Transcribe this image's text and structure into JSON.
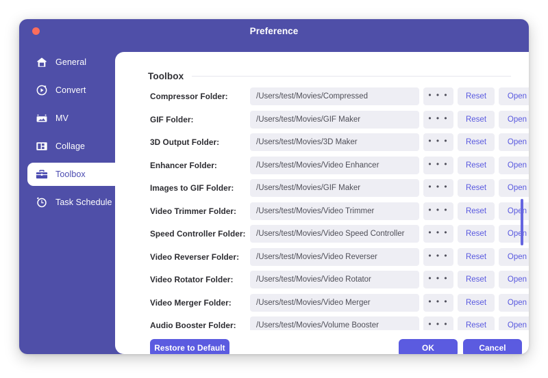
{
  "window": {
    "title": "Preference",
    "close_label": "close",
    "accent_color": "#5b5be0",
    "sidebar_color": "#4f4fa8",
    "close_color": "#fb6d5c",
    "field_bg_color": "#eeeef4",
    "link_color": "#5858df"
  },
  "sidebar": {
    "items": [
      {
        "label": "General",
        "icon": "home-icon",
        "active": false
      },
      {
        "label": "Convert",
        "icon": "convert-icon",
        "active": false
      },
      {
        "label": "MV",
        "icon": "mv-icon",
        "active": false
      },
      {
        "label": "Collage",
        "icon": "collage-icon",
        "active": false
      },
      {
        "label": "Toolbox",
        "icon": "toolbox-icon",
        "active": true
      },
      {
        "label": "Task Schedule",
        "icon": "clock-icon",
        "active": false
      }
    ]
  },
  "main": {
    "section_title": "Toolbox",
    "dots_label": "• • •",
    "reset_label": "Reset",
    "open_label": "Open",
    "rows": [
      {
        "label": "Compressor Folder:",
        "path": "/Users/test/Movies/Compressed"
      },
      {
        "label": "GIF Folder:",
        "path": "/Users/test/Movies/GIF Maker"
      },
      {
        "label": "3D Output Folder:",
        "path": "/Users/test/Movies/3D Maker"
      },
      {
        "label": "Enhancer Folder:",
        "path": "/Users/test/Movies/Video Enhancer"
      },
      {
        "label": "Images to GIF Folder:",
        "path": "/Users/test/Movies/GIF Maker"
      },
      {
        "label": "Video Trimmer Folder:",
        "path": "/Users/test/Movies/Video Trimmer"
      },
      {
        "label": "Speed Controller Folder:",
        "path": "/Users/test/Movies/Video Speed Controller"
      },
      {
        "label": "Video Reverser Folder:",
        "path": "/Users/test/Movies/Video Reverser"
      },
      {
        "label": "Video Rotator Folder:",
        "path": "/Users/test/Movies/Video Rotator"
      },
      {
        "label": "Video Merger Folder:",
        "path": "/Users/test/Movies/Video Merger"
      },
      {
        "label": "Audio Booster Folder:",
        "path": "/Users/test/Movies/Volume Booster"
      }
    ]
  },
  "footer": {
    "restore_label": "Restore to Default",
    "ok_label": "OK",
    "cancel_label": "Cancel"
  }
}
